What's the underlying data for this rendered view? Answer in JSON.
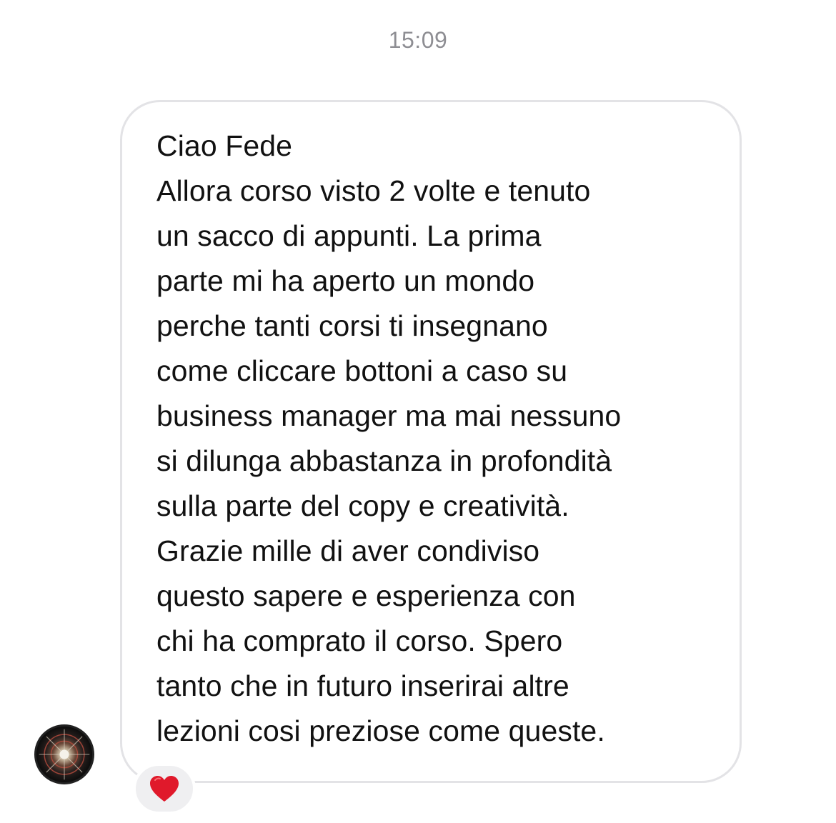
{
  "conversation": {
    "timestamp": "15:09"
  },
  "message": {
    "lines": [
      "Ciao Fede",
      "Allora corso visto 2 volte e tenuto",
      "un sacco di appunti. La prima",
      "parte mi ha aperto un mondo",
      "perche tanti corsi ti insegnano",
      "come cliccare bottoni a caso su",
      "business manager ma mai nessuno",
      "si dilunga abbastanza in profondità",
      "sulla parte del copy e creatività.",
      "Grazie mille di aver condiviso",
      "questo sapere e esperienza con",
      "chi ha comprato il corso. Spero",
      "tanto che in futuro inserirai altre",
      "lezioni cosi preziose come queste."
    ],
    "reaction": {
      "icon": "red-heart-icon",
      "color": "#e0192b"
    }
  },
  "sender": {
    "avatar_icon": "mandala-avatar"
  }
}
